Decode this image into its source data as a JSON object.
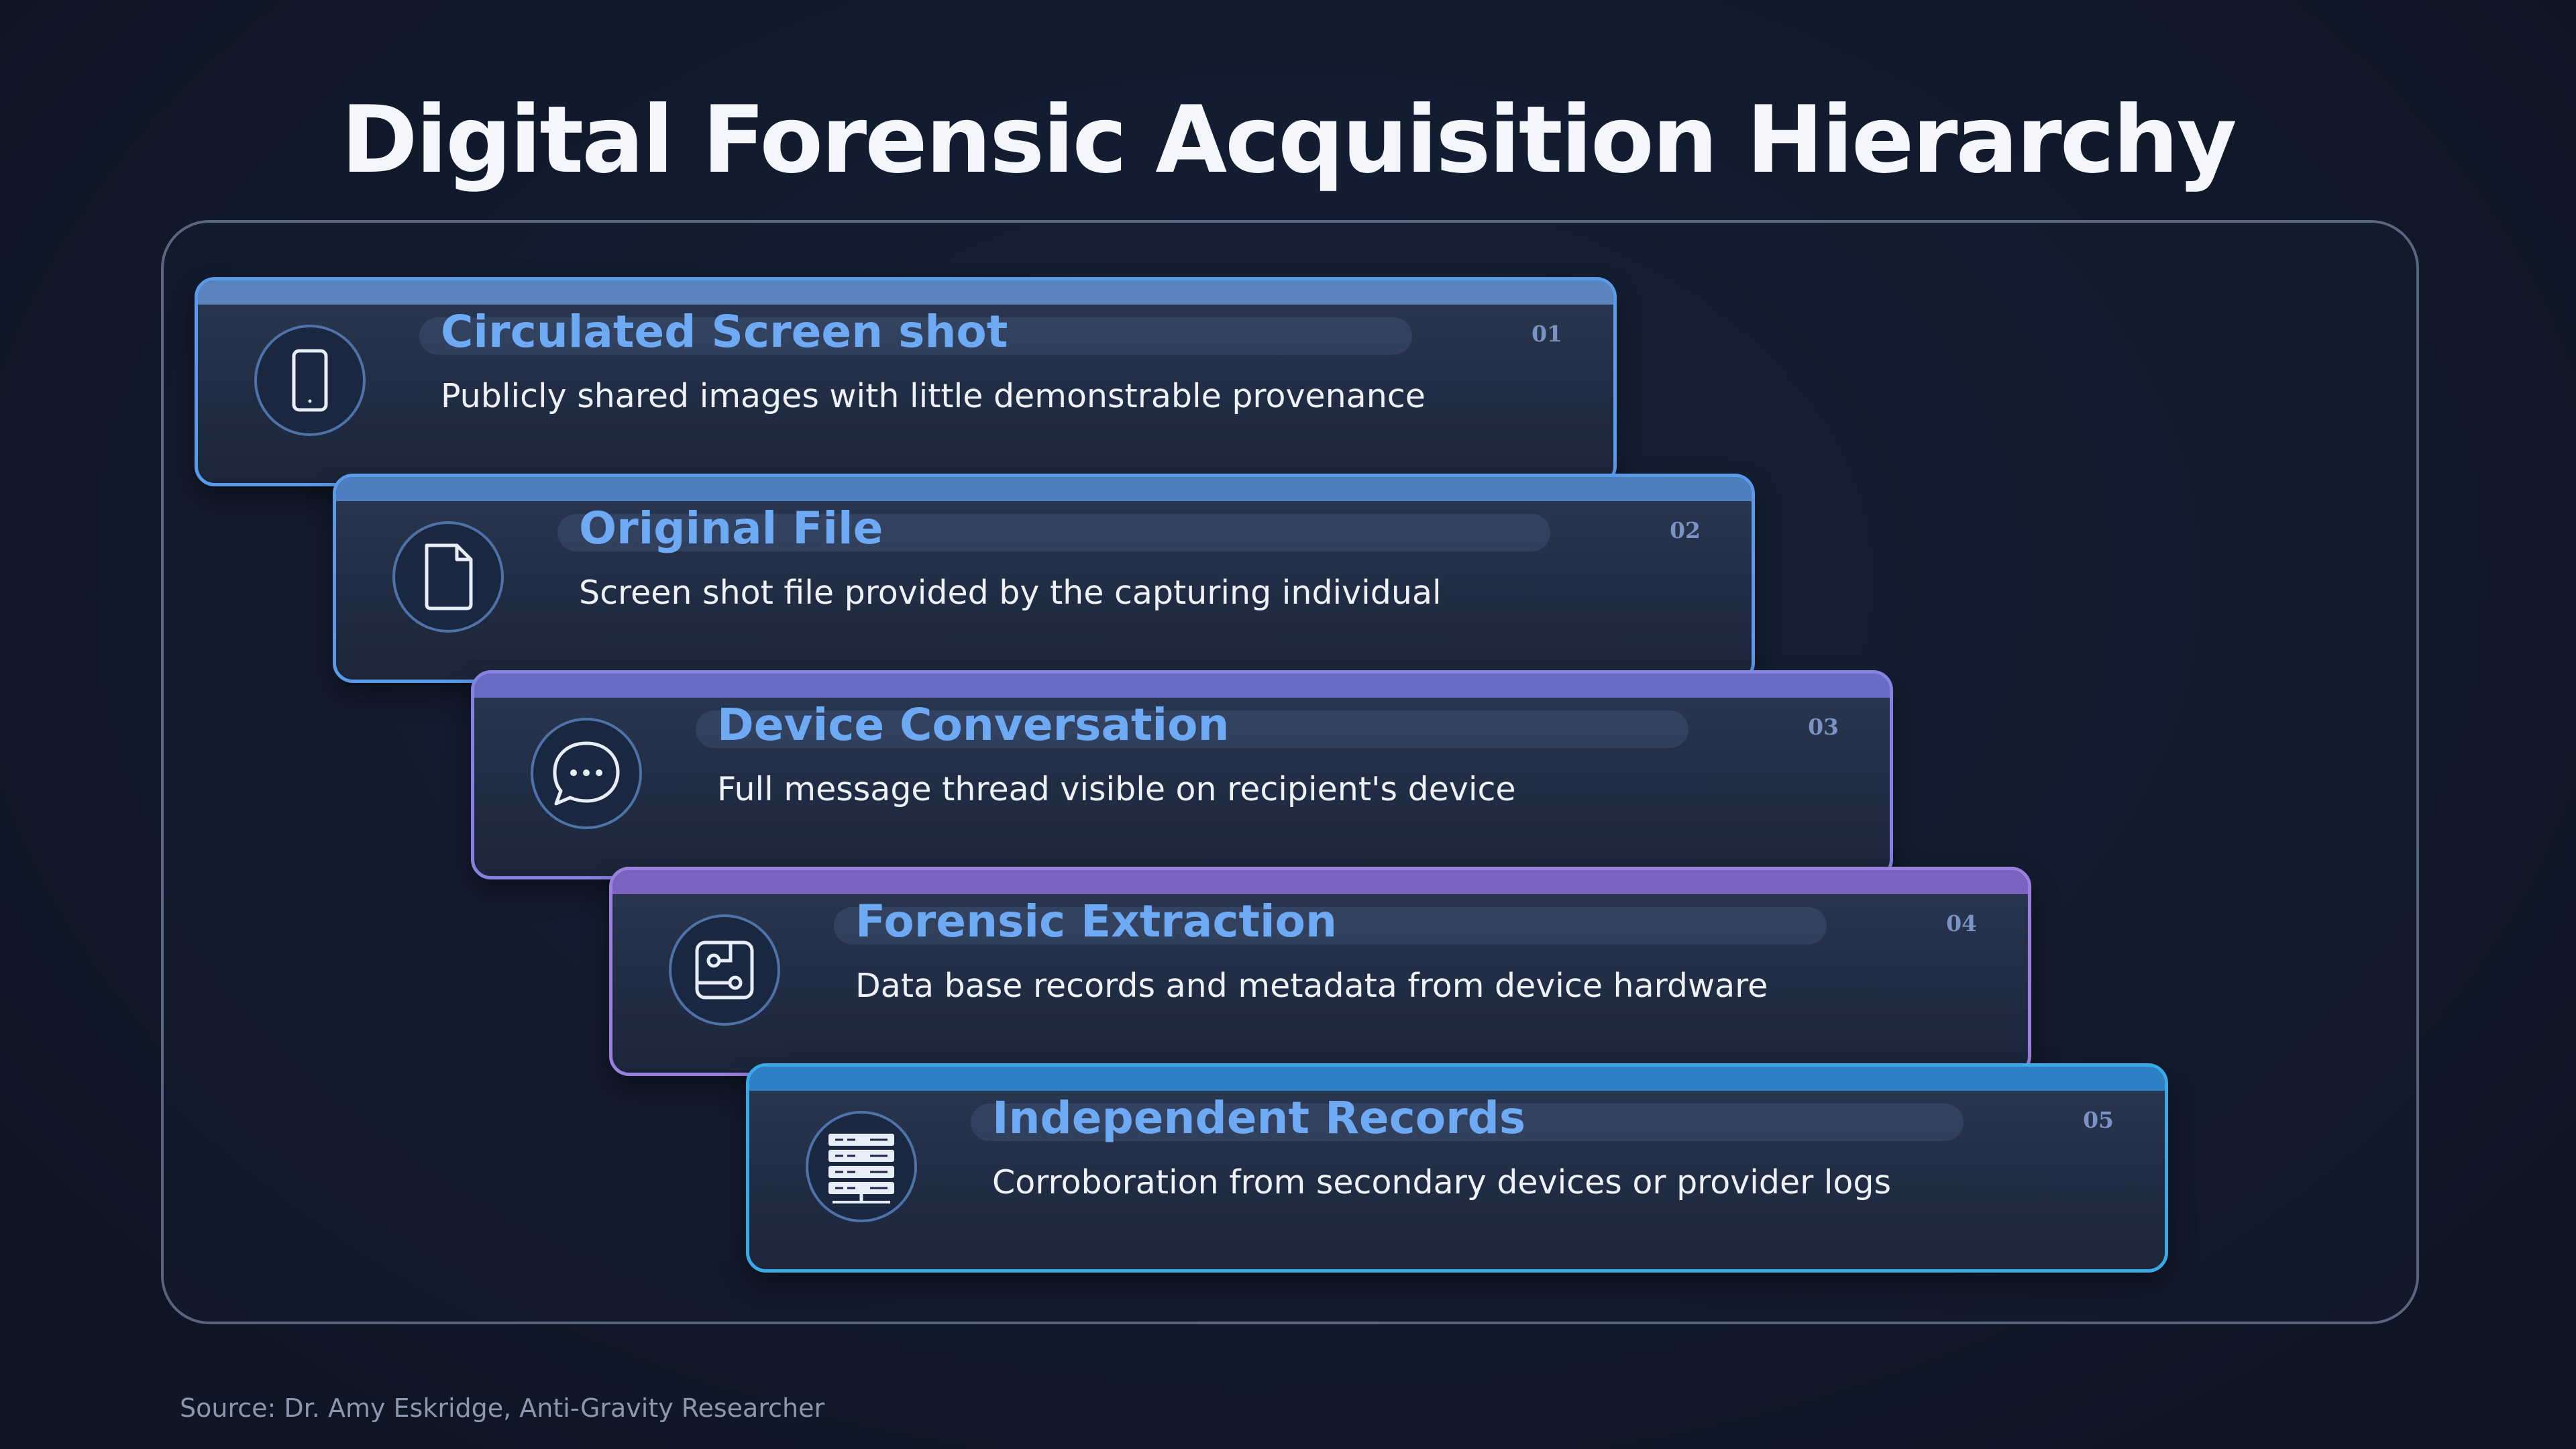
{
  "title": "Digital Forensic Acquisition Hierarchy",
  "levels": [
    {
      "title": "Circulated Screen shot",
      "description": "Publicly shared images with little demonstrable provenance",
      "number": "01",
      "icon": "phone-icon",
      "accent": "#5b9ae8"
    },
    {
      "title": "Original File",
      "description": "Screen shot file provided by the capturing individual",
      "number": "02",
      "icon": "document-icon",
      "accent": "#5b9ae8"
    },
    {
      "title": "Device Conversation",
      "description": "Full message thread visible on recipient's device",
      "number": "03",
      "icon": "chat-bubble-icon",
      "accent": "#8583e2"
    },
    {
      "title": "Forensic Extraction",
      "description": "Data base records and metadata from device hardware",
      "number": "04",
      "icon": "circuit-chip-icon",
      "accent": "#9b80dd"
    },
    {
      "title": "Independent Records",
      "description": "Corroboration from secondary devices or provider logs",
      "number": "05",
      "icon": "server-rack-icon",
      "accent": "#3ba9e6"
    }
  ],
  "source": "Source: Dr. Amy Eskridge, Anti-Gravity Researcher"
}
